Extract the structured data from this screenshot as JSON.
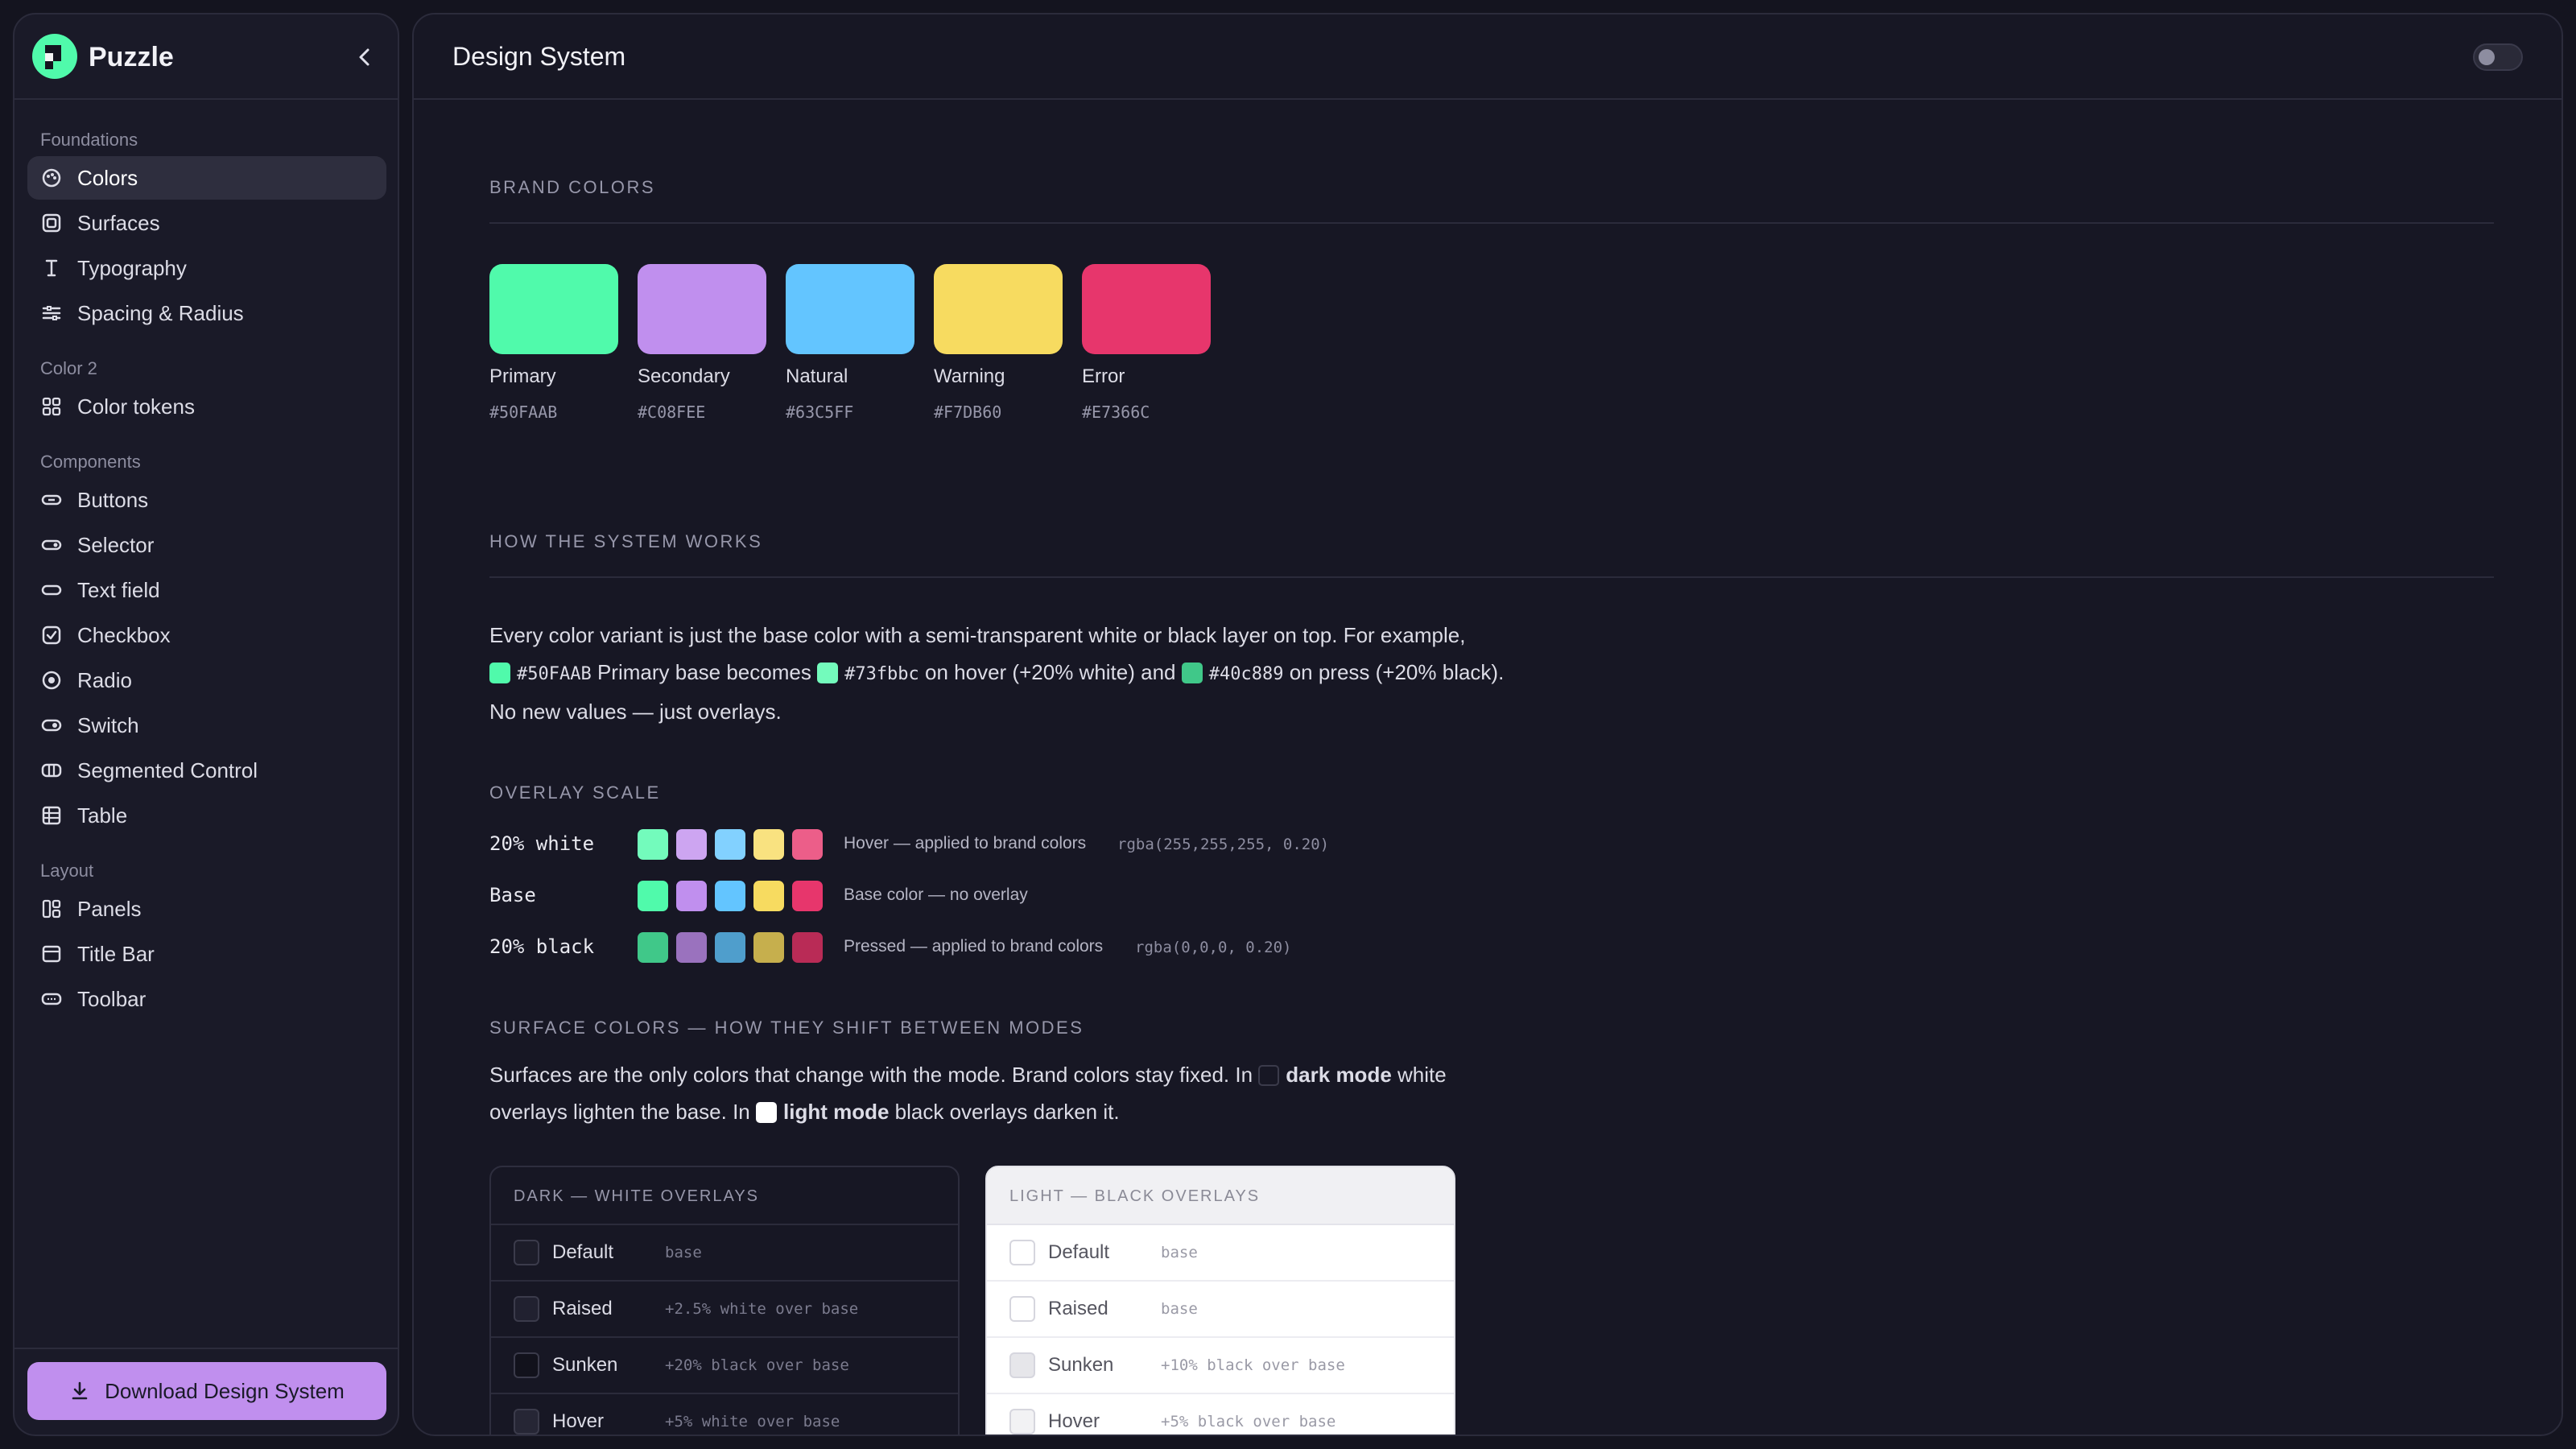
{
  "sidebar": {
    "brand": "Puzzle",
    "groups": [
      {
        "title": "Foundations",
        "items": [
          {
            "label": "Colors",
            "icon": "palette-icon",
            "active": true
          },
          {
            "label": "Surfaces",
            "icon": "square-layers-icon"
          },
          {
            "label": "Typography",
            "icon": "text-cursor-icon"
          },
          {
            "label": "Spacing & Radius",
            "icon": "sliders-icon"
          }
        ]
      },
      {
        "title": "Color 2",
        "items": [
          {
            "label": "Color tokens",
            "icon": "grid-icon"
          }
        ]
      },
      {
        "title": "Components",
        "items": [
          {
            "label": "Buttons",
            "icon": "button-icon"
          },
          {
            "label": "Selector",
            "icon": "selector-icon"
          },
          {
            "label": "Text field",
            "icon": "text-field-icon"
          },
          {
            "label": "Checkbox",
            "icon": "checkbox-icon"
          },
          {
            "label": "Radio",
            "icon": "radio-icon"
          },
          {
            "label": "Switch",
            "icon": "switch-icon"
          },
          {
            "label": "Segmented Control",
            "icon": "segmented-icon"
          },
          {
            "label": "Table",
            "icon": "table-icon"
          }
        ]
      },
      {
        "title": "Layout",
        "items": [
          {
            "label": "Panels",
            "icon": "panels-icon"
          },
          {
            "label": "Title Bar",
            "icon": "title-bar-icon"
          },
          {
            "label": "Toolbar",
            "icon": "toolbar-icon"
          }
        ]
      }
    ],
    "download_label": "Download Design System"
  },
  "header": {
    "title": "Design System"
  },
  "brand_section": {
    "title": "BRAND COLORS",
    "colors": [
      {
        "name": "Primary",
        "hex": "#50FAAB"
      },
      {
        "name": "Secondary",
        "hex": "#C08FEE"
      },
      {
        "name": "Natural",
        "hex": "#63C5FF"
      },
      {
        "name": "Warning",
        "hex": "#F7DB60"
      },
      {
        "name": "Error",
        "hex": "#E7366C"
      }
    ]
  },
  "how_section": {
    "title": "HOW THE SYSTEM WORKS",
    "line1": "Every color variant is just the base color with a semi-transparent white or black layer on top. For example,",
    "hex_base": "#50FAAB",
    "text_a": "Primary base becomes",
    "hex_hover": "#73fbbc",
    "text_b": "on hover (+20% white) and",
    "hex_press": "#40c889",
    "text_c": "on press (+20% black).",
    "line3": "No new values — just overlays."
  },
  "overlay_section": {
    "title": "OVERLAY SCALE",
    "rows": [
      {
        "label": "20% white",
        "desc": "Hover — applied to brand colors",
        "code": "rgba(255,255,255, 0.20)",
        "colors": [
          "#73FBBC",
          "#CDA5F1",
          "#82D1FF",
          "#F9E280",
          "#EC5E89"
        ]
      },
      {
        "label": "Base",
        "desc": "Base color — no overlay",
        "code": "",
        "colors": [
          "#50FAAB",
          "#C08FEE",
          "#63C5FF",
          "#F7DB60",
          "#E7366C"
        ]
      },
      {
        "label": "20% black",
        "desc": "Pressed — applied to brand colors",
        "code": "rgba(0,0,0, 0.20)",
        "colors": [
          "#40C889",
          "#9A72BE",
          "#4F9ECC",
          "#C6AF4D",
          "#B92B56"
        ]
      }
    ]
  },
  "surface_section": {
    "title": "SURFACE COLORS — HOW THEY SHIFT BETWEEN MODES",
    "text_a": "Surfaces are the only colors that change with the mode. Brand colors stay fixed. In",
    "dark_label": "dark mode",
    "text_b": "white",
    "text_c": "overlays lighten the base. In",
    "light_label": "light mode",
    "text_d": "black overlays darken it.",
    "dark_table": {
      "title": "DARK — WHITE OVERLAYS",
      "rows": [
        {
          "name": "Default",
          "desc": "base"
        },
        {
          "name": "Raised",
          "desc": "+2.5% white over base"
        },
        {
          "name": "Sunken",
          "desc": "+20% black over base"
        },
        {
          "name": "Hover",
          "desc": "+5% white over base"
        }
      ]
    },
    "light_table": {
      "title": "LIGHT — BLACK OVERLAYS",
      "rows": [
        {
          "name": "Default",
          "desc": "base"
        },
        {
          "name": "Raised",
          "desc": "base"
        },
        {
          "name": "Sunken",
          "desc": "+10% black over base"
        },
        {
          "name": "Hover",
          "desc": "+5% black over base"
        }
      ]
    }
  }
}
